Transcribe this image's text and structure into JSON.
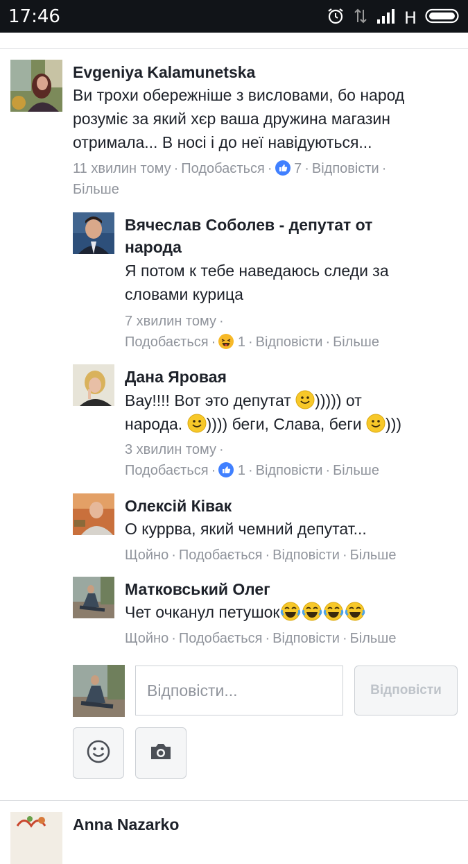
{
  "status_bar": {
    "time": "17:46",
    "network": "H"
  },
  "colors": {
    "text": "#1d2129",
    "meta": "#90949c",
    "like_blue": "#4080ff",
    "haha_yellow": "#f7b928"
  },
  "comments": [
    {
      "author": "Evgeniya Kalamunetska",
      "text_lines": [
        "Ви трохи обережніше з висловами, бо народ",
        "розуміє за який хєр ваша дружина магазин",
        "отримала... В носі і до неї навідуються..."
      ],
      "time": "11 хвилин тому",
      "like": "Подобається",
      "reaction_icon": "like-icon",
      "reaction_count": "7",
      "reply": "Відповісти",
      "more": "Більше"
    }
  ],
  "replies": [
    {
      "author_lines": [
        "Вячеслав Соболев - депутат от",
        "народа"
      ],
      "text_lines": [
        "Я потом к тебе наведаюсь следи за",
        "словами курица"
      ],
      "time": "7 хвилин тому",
      "like": "Подобається",
      "reaction_icon": "haha-icon",
      "reaction_count": "1",
      "reply": "Відповісти",
      "more": "Більше"
    },
    {
      "author": "Дана Яровая",
      "text_line1_a": "Вау!!!! Вот это депутат",
      "text_line1_b": "))))) от",
      "text_line2_a": "народа.",
      "text_line2_b": ")))) беги, Слава, беги",
      "text_line2_c": ")))",
      "time": "3 хвилин тому",
      "like": "Подобається",
      "reaction_icon": "like-icon",
      "reaction_count": "1",
      "reply": "Відповісти",
      "more": "Більше"
    },
    {
      "author": "Олексій Ківак",
      "text": "О куррва, який чемний депутат...",
      "time": "Щойно",
      "like": "Подобається",
      "reply": "Відповісти",
      "more": "Більше"
    },
    {
      "author": "Матковський Олег",
      "text": "Чет очканул петушок",
      "time": "Щойно",
      "like": "Подобається",
      "reply": "Відповісти",
      "more": "Більше"
    }
  ],
  "reply_box": {
    "placeholder": "Відповісти...",
    "submit": "Відповісти"
  },
  "next_comment": {
    "author": "Anna Nazarko"
  }
}
